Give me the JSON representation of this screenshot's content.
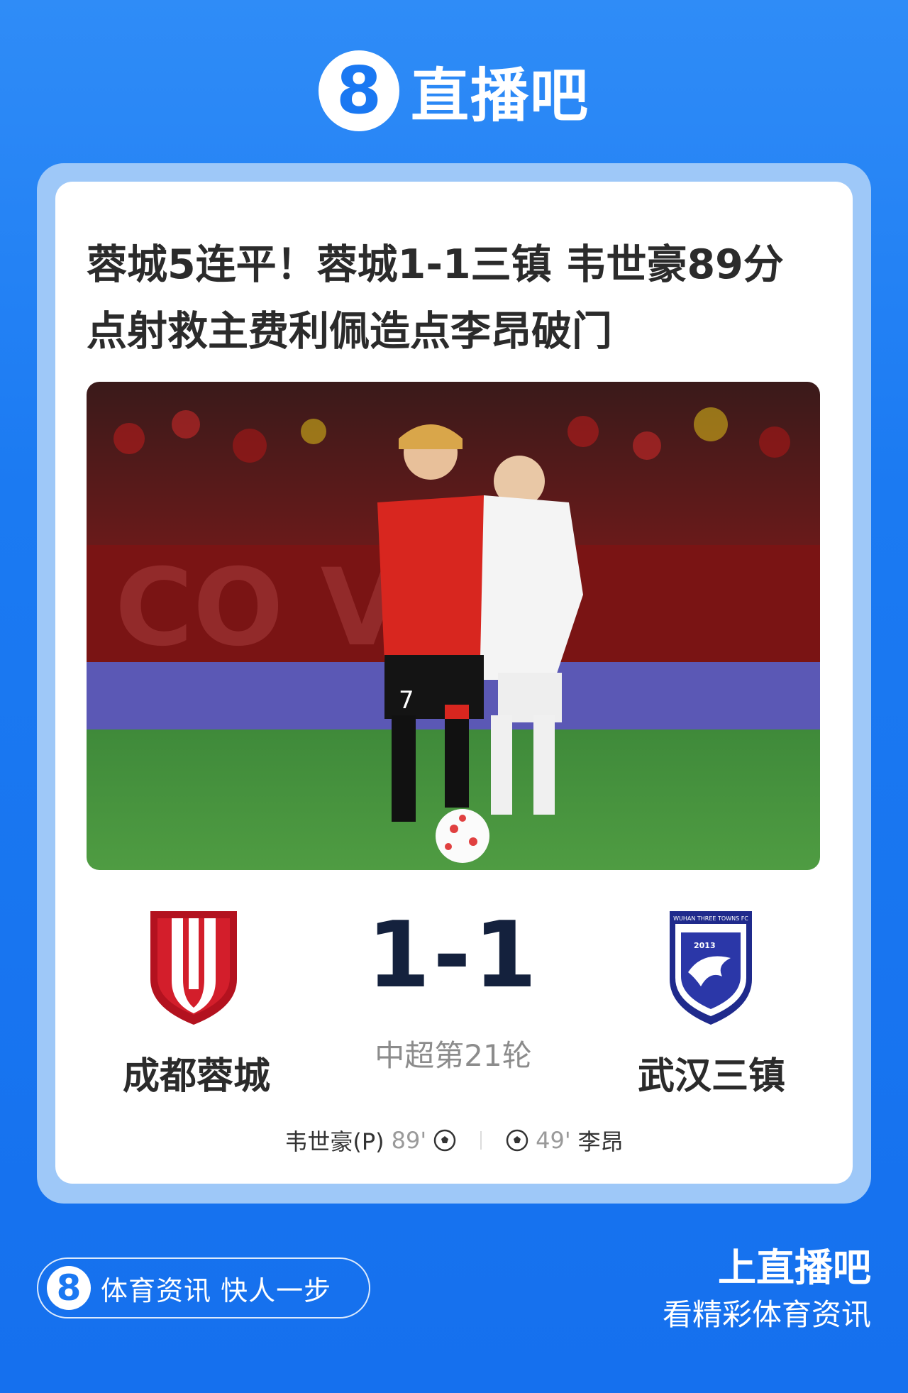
{
  "brand": {
    "logo_glyph": "8",
    "name": "直播吧"
  },
  "article": {
    "headline_line1": "蓉城5连平！蓉城1-1三镇 韦世豪89分",
    "headline_line2": "点射救主费利佩造点李昂破门"
  },
  "match": {
    "score": "1-1",
    "round": "中超第21轮",
    "home": {
      "name": "成都蓉城",
      "logo_icon": "chengdu-rongcheng-crest",
      "color": "#c8102e"
    },
    "away": {
      "name": "武汉三镇",
      "logo_icon": "wuhan-three-towns-crest",
      "color": "#1f2a8c",
      "crest_text": "WUHAN THREE TOWNS FC",
      "crest_year": "2013"
    },
    "goals": [
      {
        "player": "韦世豪(P)",
        "minute": "89'",
        "side": "home",
        "icon": "football-icon"
      },
      {
        "player": "李昂",
        "minute": "49'",
        "side": "away",
        "icon": "football-icon"
      }
    ]
  },
  "footer": {
    "pill_logo": "8",
    "slogan": "体育资讯 快人一步",
    "cta_line1": "上直播吧",
    "cta_line2": "看精彩体育资讯"
  },
  "colors": {
    "brand_blue": "#1a78f2",
    "card_border": "#9ec8f8",
    "score": "#14213d"
  }
}
